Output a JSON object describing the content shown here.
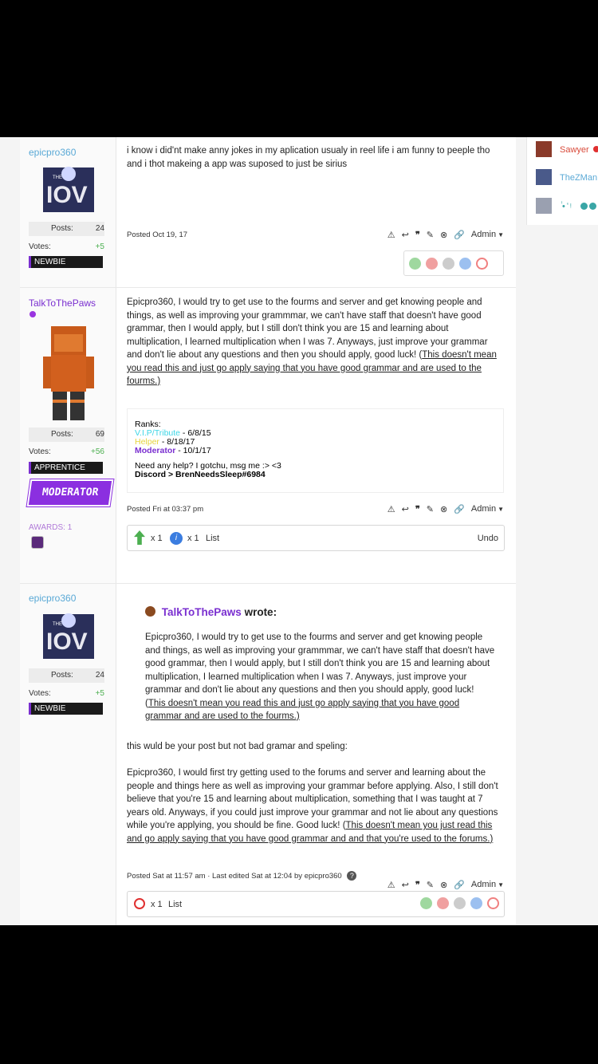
{
  "posts": [
    {
      "author": "epicpro360",
      "stats": {
        "posts_label": "Posts:",
        "posts": "24",
        "votes_label": "Votes:",
        "votes": "+5"
      },
      "rank": "NEWBIE",
      "body": "i know i did'nt make anny jokes in my aplication usualy in reel life i am funny to peeple tho and i thot makeing a app was suposed to just be sirius",
      "meta": "Posted Oct 19, 17",
      "admin_label": "Admin"
    },
    {
      "author": "TalkToThePaws",
      "stats": {
        "posts_label": "Posts:",
        "posts": "69",
        "votes_label": "Votes:",
        "votes": "+56"
      },
      "rank": "APPRENTICE",
      "badge": "MODERATOR",
      "awards": "AWARDS: 1",
      "body": "Epicpro360, I would try to get use to the fourms and server and get knowing people and things, as well as improving your grammmar, we can't have staff that doesn't have good grammar, then I would apply, but I still don't think you are 15 and learning about multiplication, I learned multiplication when I was 7. Anyways, just improve your grammar and don't lie about any questions and then you should apply, good luck! (",
      "body_link": "This doesn't mean you read this and just go apply saying that you have good grammar and are used to the fourms.)",
      "signature": {
        "ranks_label": "Ranks:",
        "rank1": "V.I.P/Tribute",
        "rank1_date": " - 6/8/15",
        "rank2": "Helper",
        "rank2_date": " - 8/18/17",
        "rank3": "Moderator",
        "rank3_date": " - 10/1/17",
        "help": "Need any help? I gotchu, msg me :> <3",
        "discord": "Discord > BrenNeedsSleep#6984"
      },
      "meta": "Posted Fri at 03:37 pm",
      "admin_label": "Admin",
      "reactions": {
        "count1": "x 1",
        "count2": "x 1",
        "list": "List",
        "undo": "Undo"
      }
    },
    {
      "author": "epicpro360",
      "stats": {
        "posts_label": "Posts:",
        "posts": "24",
        "votes_label": "Votes:",
        "votes": "+5"
      },
      "rank": "NEWBIE",
      "quote_author": "TalkToThePaws",
      "quote_wrote": "wrote:",
      "quote_body": "Epicpro360, I would try to get use to the fourms and server and get knowing people and things, as well as improving your grammmar, we can't have staff that doesn't have good grammar, then I would apply, but I still don't think you are 15 and learning about multiplication, I learned multiplication when I was 7. Anyways, just improve your grammar and don't lie about any questions and then you should apply, good luck! (",
      "quote_link": "This doesn't mean you read this and just go apply saying that you have good grammar and are used to the fourms.)",
      "body1": "this wuld be your post but not bad gramar and speling:",
      "body2": "Epicpro360, I would first try getting used to the forums and server and learning about the people and things here as well as improving your grammar before applying. Also, I still don't believe that you're 15 and learning about multiplication, something that I was taught at 7 years old. Anyways, if you could just improve your grammar and not lie about any questions while you're applying, you should be fine. Good luck! (",
      "body2_link": "This doesn't mean you just read this and go apply saying that you have good grammar and and that you're used to the forums.)",
      "meta": "Posted Sat at 11:57 am · Last edited Sat at 12:04 by epicpro360",
      "admin_label": "Admin",
      "reactions": {
        "count": "x 1",
        "list": "List"
      }
    }
  ],
  "sidebar": [
    {
      "name": "Sawyer",
      "color": "#d94a3a"
    },
    {
      "name": "TheZMan",
      "color": "#5aa9d6"
    },
    {
      "name": "ٰ • ̒ ᵎ ",
      "color": "#3aa6a6"
    }
  ],
  "colors": {
    "link": "#5aa9d6",
    "purple": "#7a2fd0",
    "green": "#4caf50",
    "vip": "#3dd6e6",
    "helper": "#e6d43d"
  }
}
